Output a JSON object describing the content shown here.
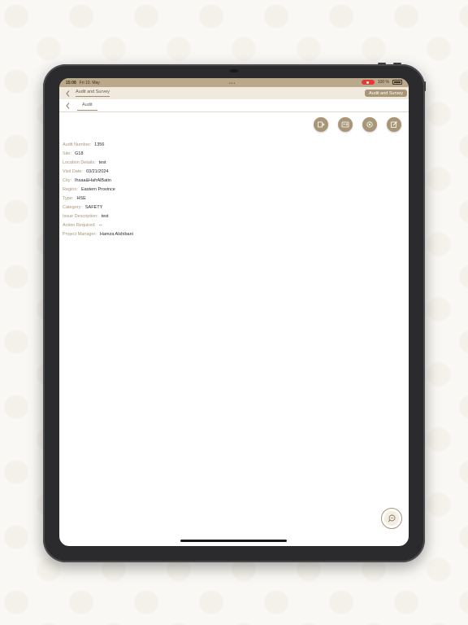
{
  "statusbar": {
    "time": "15:08",
    "date": "Fri 10. May",
    "battery": "100 %"
  },
  "navbar": {
    "parent_title": "Audit and Survey",
    "badge": "Audit and Survey"
  },
  "tab": {
    "label": "Audit"
  },
  "actions": [
    {
      "icon": "assign-icon"
    },
    {
      "icon": "id-card-icon"
    },
    {
      "icon": "settings-icon"
    },
    {
      "icon": "edit-icon"
    }
  ],
  "fields": [
    {
      "label": "Audit Number:",
      "value": "1356"
    },
    {
      "label": "Site:",
      "value": "G18"
    },
    {
      "label": "Location Details:",
      "value": "test"
    },
    {
      "label": "Visit Date:",
      "value": "03/21/2024"
    },
    {
      "label": "City:",
      "value": "Ihsaa&HafrAlBatin"
    },
    {
      "label": "Region:",
      "value": "Eastern Province"
    },
    {
      "label": "Type:",
      "value": "HSE"
    },
    {
      "label": "Category:",
      "value": "SAFETY"
    },
    {
      "label": "Issue Description:",
      "value": "test"
    },
    {
      "label": "Action Required:",
      "value": "--"
    },
    {
      "label": "Project Manager:",
      "value": "Hamza Alshibani"
    }
  ],
  "fab": {
    "icon": "search-chat-icon"
  },
  "colors": {
    "accent": "#a89677",
    "header": "#b9a88a",
    "nav": "#efe9de"
  }
}
